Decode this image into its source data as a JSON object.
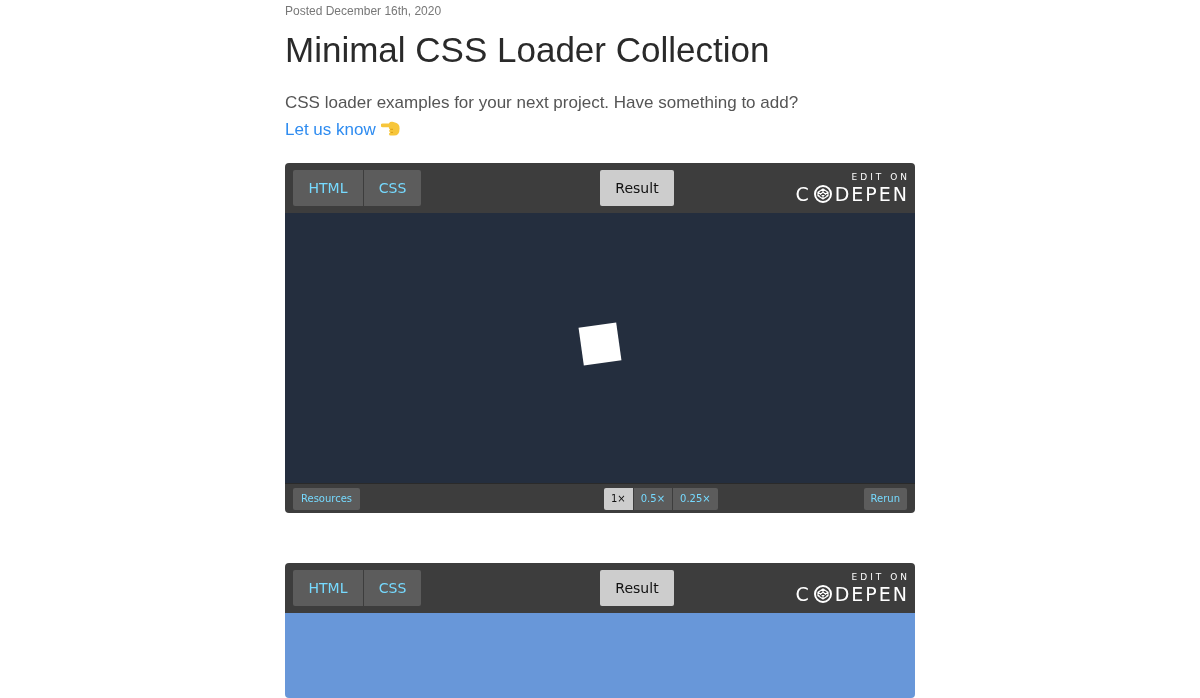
{
  "post": {
    "date": "Posted December 16th, 2020",
    "title": "Minimal CSS Loader Collection",
    "intro": "CSS loader examples for your next project. Have something to add?",
    "link": "Let us know"
  },
  "embeds": [
    {
      "tabs": [
        {
          "label": "HTML",
          "kind": "code",
          "selected": false
        },
        {
          "label": "CSS",
          "kind": "code",
          "selected": false
        },
        {
          "label": "Result",
          "kind": "result",
          "selected": true
        }
      ],
      "edit_link": {
        "caption": "EDIT ON",
        "wordmark_start": "C",
        "wordmark_end": "DEPEN"
      },
      "preview": {
        "color": "#242e3e",
        "kind": "square"
      },
      "footer": {
        "resources": "Resources",
        "zoom": [
          {
            "label": "1×",
            "selected": true
          },
          {
            "label": "0.5×",
            "selected": false
          },
          {
            "label": "0.25×",
            "selected": false
          }
        ],
        "rerun": "Rerun"
      }
    },
    {
      "tabs": [
        {
          "label": "HTML",
          "kind": "code",
          "selected": false
        },
        {
          "label": "CSS",
          "kind": "code",
          "selected": false
        },
        {
          "label": "Result",
          "kind": "result",
          "selected": true
        }
      ],
      "edit_link": {
        "caption": "EDIT ON",
        "wordmark_start": "C",
        "wordmark_end": "DEPEN"
      },
      "preview": {
        "color": "#6897d9"
      }
    }
  ]
}
